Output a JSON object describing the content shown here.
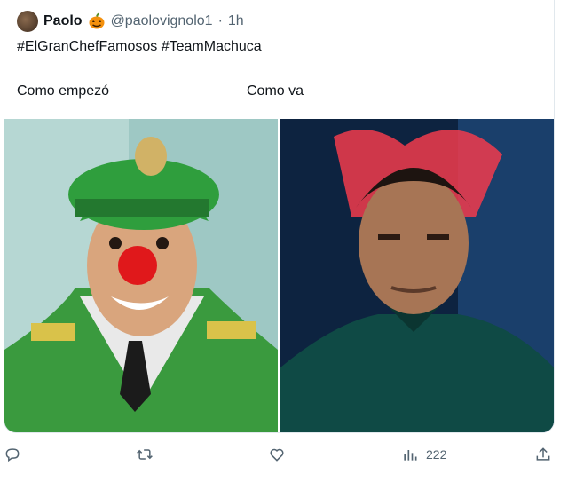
{
  "tweet": {
    "author_name": "Paolo",
    "emoji": "🎃",
    "handle": "@paolovignolo1",
    "separator": "·",
    "time": "1h",
    "text": "#ElGranChefFamosos #TeamMachuca",
    "caption_left": "Como empezó",
    "caption_right": "Como va"
  },
  "actions": {
    "views_count": "222"
  },
  "icons": [
    "reply-icon",
    "retweet-icon",
    "like-icon",
    "views-icon",
    "share-icon"
  ],
  "colors": {
    "text": "#0f1419",
    "muted": "#536471",
    "border": "#e1e8ed"
  }
}
